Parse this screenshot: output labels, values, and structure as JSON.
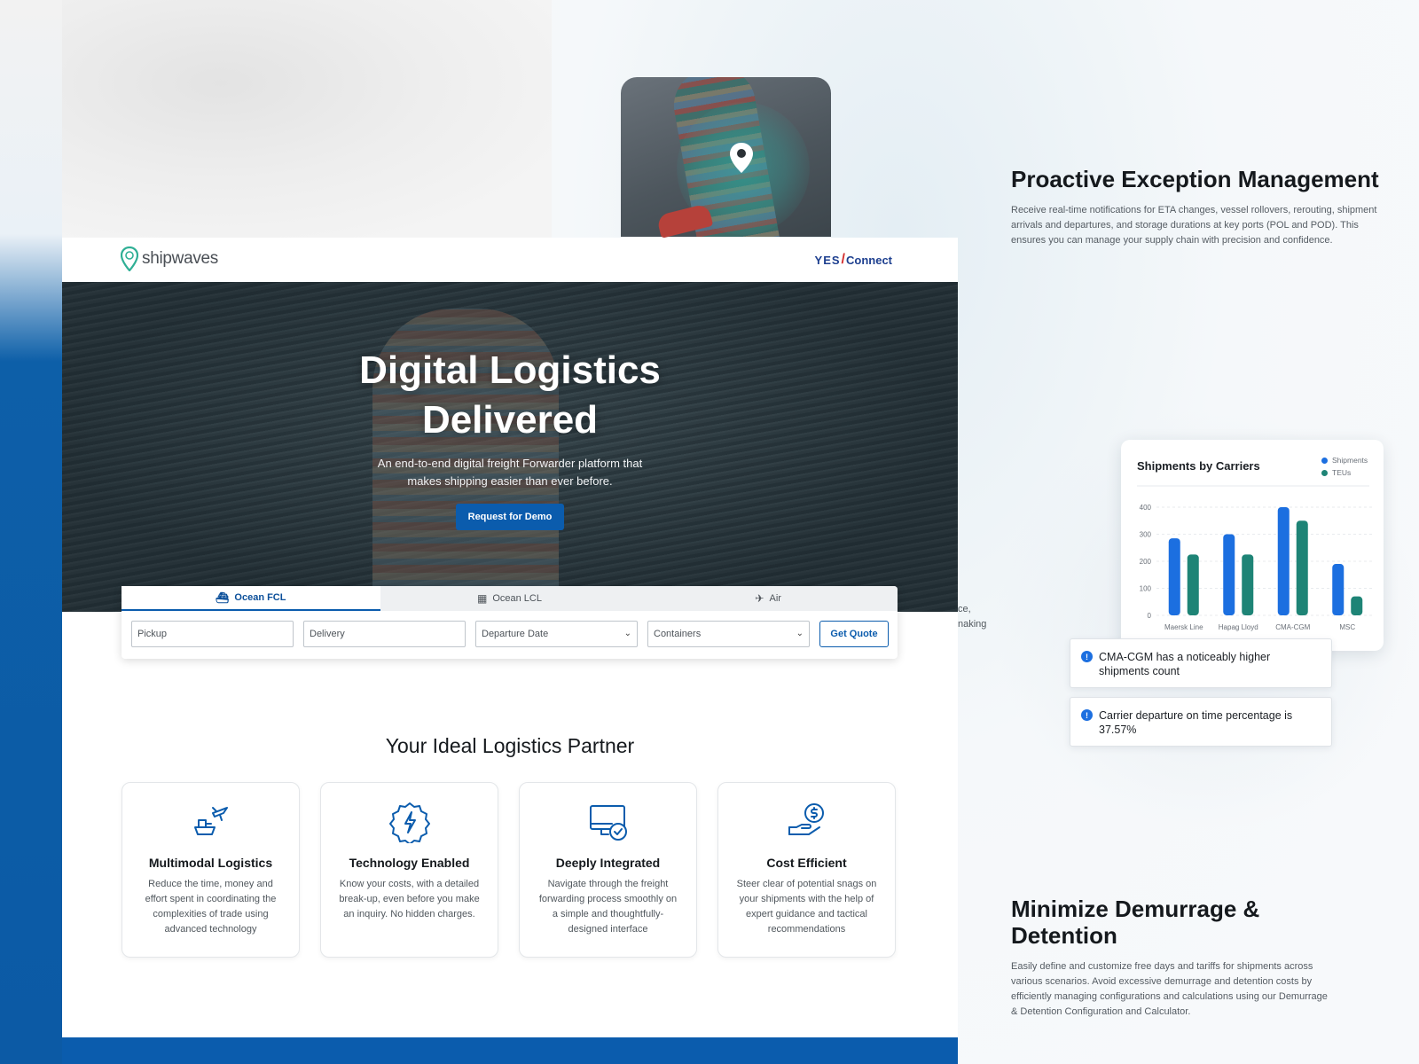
{
  "colors": {
    "brand_blue": "#0b5cad",
    "shipments": "#1c6fe0",
    "teus": "#1e8476",
    "accent_teal": "#2faf95"
  },
  "ship_card": {
    "pin_icon": "location-pin-icon"
  },
  "features": {
    "proactive": {
      "title": "Proactive Exception Management",
      "text": "Receive real-time notifications for ETA changes, vessel rollovers, rerouting, shipment arrivals and departures, and storage durations at key ports (POL and POD). This ensures you can manage your supply chain with precision and confidence."
    },
    "demurrage": {
      "title": "Minimize Demurrage & Detention",
      "text": "Easily define and customize free days and tariffs for shipments across various scenarios. Avoid excessive demurrage and detention costs by efficiently managing configurations and calculations using our Demurrage & Detention Configuration and Calculator."
    }
  },
  "chart_data": {
    "type": "bar",
    "title": "Shipments by Carriers",
    "categories": [
      "Maersk Line",
      "Hapag Lloyd",
      "CMA-CGM",
      "MSC"
    ],
    "series": [
      {
        "name": "Shipments",
        "values": [
          285,
          300,
          400,
          190
        ],
        "color": "#1c6fe0"
      },
      {
        "name": "TEUs",
        "values": [
          225,
          225,
          350,
          70
        ],
        "color": "#1e8476"
      }
    ],
    "yticks": [
      "0",
      "100",
      "200",
      "300",
      "400"
    ],
    "ylim": [
      0,
      400
    ],
    "legend": "top-right",
    "grid": true
  },
  "notes": [
    {
      "text": "CMA-CGM has a noticeably higher shipments count",
      "icon": "info-icon"
    },
    {
      "text": "Carrier departure on time percentage is 37.57%",
      "icon": "info-icon"
    }
  ],
  "site": {
    "logo_text": "shipwaves",
    "partner": {
      "yes": "YES",
      "slash": "/",
      "connect": "Connect"
    },
    "hero": {
      "title": "Digital Logistics Delivered",
      "subtitle": "An end-to-end digital freight Forwarder platform that makes shipping easier than ever before.",
      "demo_button": "Request for Demo"
    },
    "quote": {
      "tabs": [
        {
          "label": "Ocean FCL",
          "icon": "ship-icon",
          "active": true
        },
        {
          "label": "Ocean LCL",
          "icon": "container-icon",
          "active": false
        },
        {
          "label": "Air",
          "icon": "plane-icon",
          "active": false
        }
      ],
      "pickup_placeholder": "Pickup",
      "delivery_placeholder": "Delivery",
      "departure_date": "Departure Date",
      "containers": "Containers",
      "get_quote": "Get Quote"
    },
    "partner_section_title": "Your Ideal Logistics Partner",
    "cards": [
      {
        "title": "Multimodal Logistics",
        "text": "Reduce the time, money and effort spent in coordinating the complexities of trade using advanced technology",
        "icon": "multimodal-icon"
      },
      {
        "title": "Technology Enabled",
        "text": "Know your costs, with a detailed break-up, even before you make an inquiry. No hidden charges.",
        "icon": "lightning-badge-icon"
      },
      {
        "title": "Deeply Integrated",
        "text": "Navigate through the freight forwarding process smoothly on a simple and thoughtfully-designed interface",
        "icon": "monitor-check-icon"
      },
      {
        "title": "Cost Efficient",
        "text": "Steer clear of potential snags on your shipments with the help of expert guidance and tactical recommendations",
        "icon": "hand-dollar-icon"
      }
    ],
    "peek_text": [
      "ce,",
      "naking"
    ]
  }
}
